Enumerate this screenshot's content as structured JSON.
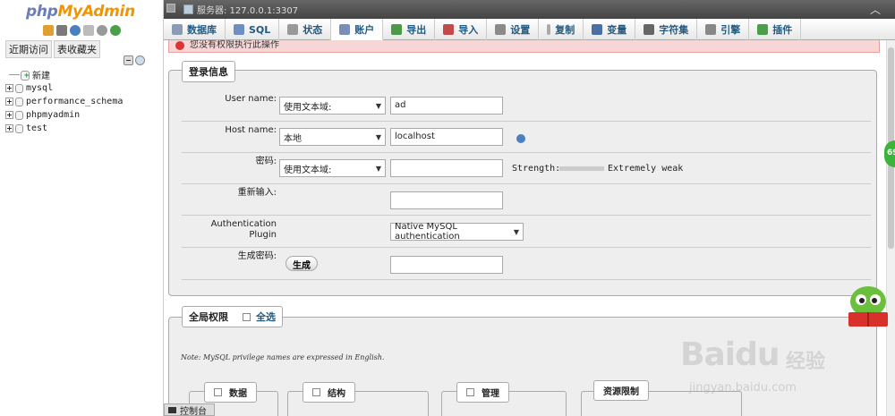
{
  "nav": {
    "logo_php": "php",
    "logo_admin": "MyAdmin",
    "recent_link": "近期访问",
    "favorites_link": "表收藏夹",
    "tree": [
      {
        "name": "新建",
        "type": "new"
      },
      {
        "name": "mysql",
        "type": "db"
      },
      {
        "name": "performance_schema",
        "type": "db"
      },
      {
        "name": "phpmyadmin",
        "type": "db"
      },
      {
        "name": "test",
        "type": "db"
      }
    ]
  },
  "topbar": {
    "server": "服务器: 127.0.0.1:3307"
  },
  "tabs": [
    {
      "label": "数据库",
      "icon": "database-icon",
      "color": "#8a9bb5"
    },
    {
      "label": "SQL",
      "icon": "sql-icon",
      "color": "#6f8fc4"
    },
    {
      "label": "状态",
      "icon": "status-icon",
      "color": "#999999"
    },
    {
      "label": "账户",
      "icon": "users-icon",
      "color": "#7a8fb5"
    },
    {
      "label": "导出",
      "icon": "export-icon",
      "color": "#4a9a4a"
    },
    {
      "label": "导入",
      "icon": "import-icon",
      "color": "#c24a4a"
    },
    {
      "label": "设置",
      "icon": "wrench-icon",
      "color": "#8a8a8a"
    },
    {
      "label": "复制",
      "icon": "replication-icon",
      "color": "#aaaaaa"
    },
    {
      "label": "变量",
      "icon": "variables-icon",
      "color": "#4a6fa5"
    },
    {
      "label": "字符集",
      "icon": "charset-icon",
      "color": "#666666"
    },
    {
      "label": "引擎",
      "icon": "engine-icon",
      "color": "#888888"
    },
    {
      "label": "插件",
      "icon": "plugin-icon",
      "color": "#4aa04a"
    }
  ],
  "error": {
    "text": "您没有权限执行此操作"
  },
  "login": {
    "legend": "登录信息",
    "user_label": "User name:",
    "user_select": "使用文本域:",
    "user_value": "ad",
    "host_label": "Host name:",
    "host_select": "本地",
    "host_value": "localhost",
    "password_label": "密码:",
    "password_select": "使用文本域:",
    "password_value": "",
    "strength_label": "Strength:",
    "strength_value": "Extremely weak",
    "retype_label": "重新输入:",
    "retype_value": "",
    "auth_label_1": "Authentication",
    "auth_label_2": "Plugin",
    "auth_select": "Native MySQL authentication",
    "gen_label": "生成密码:",
    "gen_button": "生成",
    "gen_value": ""
  },
  "privileges": {
    "legend": "全局权限",
    "select_all": "全选",
    "note": "Note: MySQL privilege names are expressed in English.",
    "groups": [
      "数据",
      "结构",
      "管理",
      "资源限制"
    ]
  },
  "console": {
    "label": "控制台"
  },
  "overlay": {
    "badge": "69",
    "watermark_logo": "Baidu",
    "watermark_cn": "经验",
    "watermark_url": "jingyan.baidu.com"
  }
}
